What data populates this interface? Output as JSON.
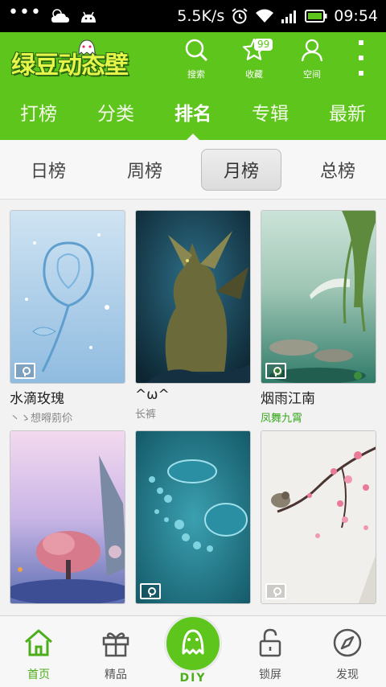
{
  "status_bar": {
    "network_speed": "5.5K/s",
    "time": "09:54",
    "dots": "•••"
  },
  "header": {
    "logo_text": "绿豆动态壁纸",
    "actions": [
      {
        "label": "搜索",
        "icon": "search-icon"
      },
      {
        "label": "收藏",
        "icon": "star-icon",
        "badge": "99"
      },
      {
        "label": "空间",
        "icon": "user-icon"
      }
    ]
  },
  "tabs": [
    {
      "label": "打榜"
    },
    {
      "label": "分类"
    },
    {
      "label": "排名",
      "active": true
    },
    {
      "label": "专辑"
    },
    {
      "label": "最新"
    }
  ],
  "subtabs": [
    {
      "label": "日榜"
    },
    {
      "label": "周榜"
    },
    {
      "label": "月榜",
      "active": true
    },
    {
      "label": "总榜"
    }
  ],
  "wallpapers": [
    {
      "title": "水滴玫瑰",
      "author": "丶ゝ想嘚莂伱",
      "locked": true
    },
    {
      "title": "^ω^",
      "author": "长裤",
      "locked": false
    },
    {
      "title": "烟雨江南",
      "author": "凤舞九霄",
      "locked": true,
      "author_color": "#36a81c"
    },
    {
      "title": "",
      "author": "",
      "locked": false
    },
    {
      "title": "",
      "author": "",
      "locked": true
    },
    {
      "title": "",
      "author": "",
      "locked": true
    }
  ],
  "bottom_nav": [
    {
      "label": "首页",
      "icon": "home-icon",
      "active": true
    },
    {
      "label": "精品",
      "icon": "gift-icon"
    },
    {
      "label": "DIY",
      "icon": "ghost-icon"
    },
    {
      "label": "锁屏",
      "icon": "unlock-icon"
    },
    {
      "label": "发现",
      "icon": "compass-icon"
    }
  ],
  "colors": {
    "brand_green": "#5ec51c",
    "accent_green": "#4cae1a"
  }
}
